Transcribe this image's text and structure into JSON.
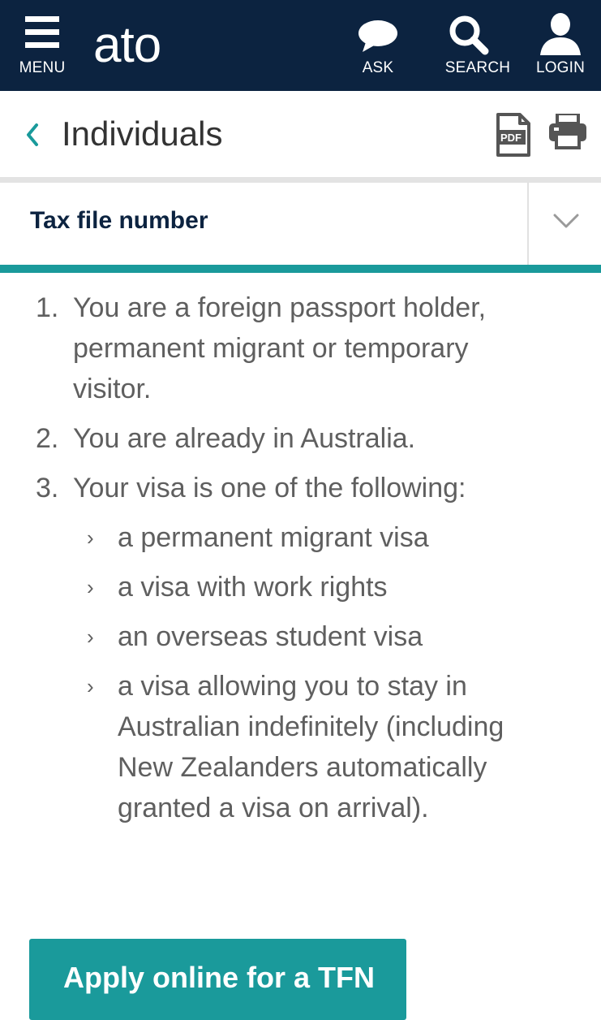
{
  "header": {
    "menu_label": "MENU",
    "logo_text": "ato",
    "ask_label": "ASK",
    "search_label": "SEARCH",
    "login_label": "LOGIN"
  },
  "breadcrumb": {
    "title": "Individuals",
    "pdf_icon_text": "PDF"
  },
  "section": {
    "title": "Tax file number"
  },
  "list": {
    "items": [
      {
        "num": "1.",
        "text": "You are a foreign passport holder, permanent migrant or temporary visitor."
      },
      {
        "num": "2.",
        "text": "You are already in Australia."
      },
      {
        "num": "3.",
        "text": "Your visa is one of the following:"
      }
    ],
    "sub_items": [
      "a permanent migrant visa",
      "a visa with work rights",
      "an overseas student visa",
      "a visa allowing you to stay in Australian indefinitely (including New Zealanders automatically granted a visa on arrival)."
    ],
    "bullet_glyph": "›"
  },
  "cta": {
    "label": "Apply online for a TFN"
  },
  "colors": {
    "header_bg": "#0c2340",
    "accent_teal": "#1a9a9b",
    "body_text": "#5f5f5f",
    "title_navy": "#0c2340"
  }
}
